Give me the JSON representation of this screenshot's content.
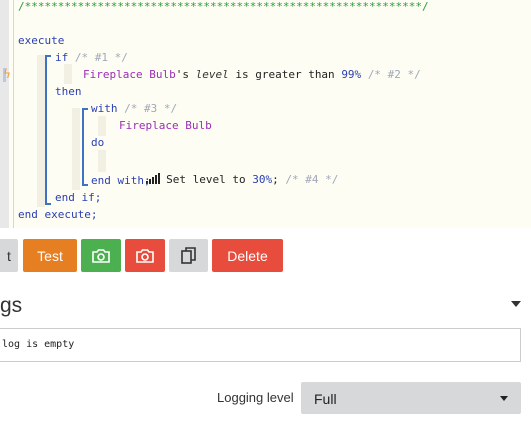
{
  "code": {
    "header_line": "/************************************************************/",
    "execute_kw": "execute",
    "if_kw": "if",
    "if_comment": "/* #1 */",
    "cond_device": "Fireplace Bulb",
    "cond_possessive": "'s",
    "cond_attr": "level",
    "cond_op": "is greater than",
    "cond_value": "99%",
    "cond_comment": "/* #2 */",
    "then_kw": "then",
    "with_kw": "with",
    "with_comment": "/* #3 */",
    "with_device": "Fireplace Bulb",
    "do_kw": "do",
    "action_text": "Set level to",
    "action_value": "30%",
    "action_end": ";",
    "action_comment": "/* #4 */",
    "endwith_kw": "end with;",
    "endif_kw": "end if;",
    "endexecute_kw": "end execute;",
    "action_icon": "signal-bars-icon",
    "gutter_icon": "lightning-bolt-icon"
  },
  "toolbar": {
    "partial_label": "t",
    "test_label": "Test",
    "snapshot_green_icon": "camera-icon",
    "snapshot_red_icon": "camera-icon",
    "copy_icon": "copy-icon",
    "delete_label": "Delete",
    "colors": {
      "test": "#e67e22",
      "green": "#4caf50",
      "red": "#e74c3c",
      "grey": "#d6d8d9",
      "delete": "#e74c3c"
    }
  },
  "logs": {
    "title": "gs",
    "empty_text": "log is empty"
  },
  "logging": {
    "label": "Logging level",
    "value": "Full"
  }
}
